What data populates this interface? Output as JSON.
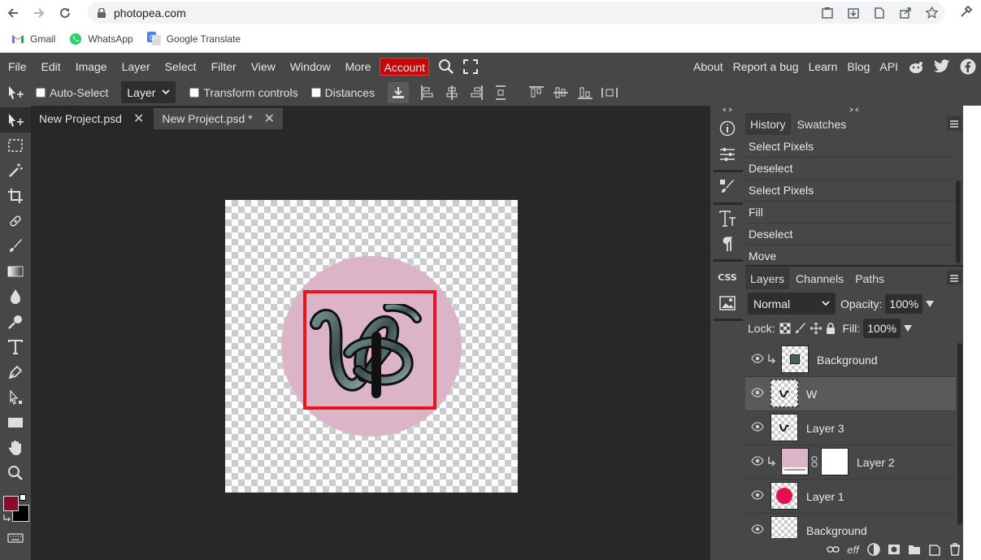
{
  "browser": {
    "url": "photopea.com",
    "bookmarks": [
      {
        "label": "Gmail",
        "icon": "gmail-icon"
      },
      {
        "label": "WhatsApp",
        "icon": "whatsapp-icon"
      },
      {
        "label": "Google Translate",
        "icon": "google-translate-icon"
      }
    ]
  },
  "menubar": {
    "items": [
      "File",
      "Edit",
      "Image",
      "Layer",
      "Select",
      "Filter",
      "View",
      "Window",
      "More"
    ],
    "account": "Account",
    "right_items": [
      "About",
      "Report a bug",
      "Learn",
      "Blog",
      "API"
    ]
  },
  "options": {
    "auto_select": "Auto-Select",
    "target_select": "Layer",
    "transform_controls": "Transform controls",
    "distances": "Distances"
  },
  "documents": {
    "tabs": [
      {
        "label": "New Project.psd",
        "active": false
      },
      {
        "label": "New Project.psd *",
        "active": true
      }
    ]
  },
  "colors": {
    "foreground": "#8b0a2c",
    "background": "#000000",
    "accent_red": "#e8141e",
    "pink": "#dcb4c8"
  },
  "history": {
    "tabs": [
      "History",
      "Swatches"
    ],
    "items": [
      "Select Pixels",
      "Deselect",
      "Select Pixels",
      "Fill",
      "Deselect",
      "Move"
    ]
  },
  "layers_panel": {
    "tabs": [
      "Layers",
      "Channels",
      "Paths"
    ],
    "blend_mode": "Normal",
    "opacity_label": "Opacity:",
    "opacity": "100%",
    "lock_label": "Lock:",
    "fill_label": "Fill:",
    "fill": "100%",
    "layers": [
      {
        "name": "Background",
        "clipped": true,
        "selected": false
      },
      {
        "name": "W",
        "clipped": false,
        "selected": true
      },
      {
        "name": "Layer 3",
        "clipped": false,
        "selected": false
      },
      {
        "name": "Layer 2",
        "clipped": true,
        "selected": false
      },
      {
        "name": "Layer 1",
        "clipped": false,
        "selected": false
      },
      {
        "name": "Background",
        "clipped": false,
        "selected": false
      }
    ],
    "bottom_icons": [
      "link-icon",
      "effects-icon",
      "adjustment-icon",
      "mask-icon",
      "folder-icon",
      "new-layer-icon",
      "trash-icon"
    ],
    "effects_label": "eff"
  }
}
